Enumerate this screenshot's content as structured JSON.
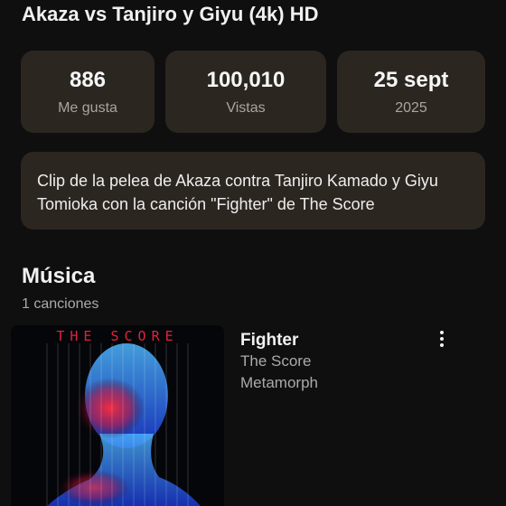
{
  "video": {
    "title": "Akaza vs Tanjiro y Giyu (4k) HD"
  },
  "stats": [
    {
      "value": "886",
      "label": "Me gusta"
    },
    {
      "value": "100,010",
      "label": "Vistas"
    },
    {
      "value": "25 sept",
      "label": "2025"
    }
  ],
  "description": "Clip de la pelea de Akaza contra Tanjiro Kamado y Giyu Tomioka con la canción \"Fighter\" de The Score",
  "music": {
    "heading": "Música",
    "count": "1 canciones",
    "tracks": [
      {
        "title": "Fighter",
        "artist": "The Score",
        "album": "Metamorph",
        "art_text": "THE SCORE",
        "more_icon": "more-vert-icon"
      }
    ]
  },
  "colors": {
    "background": "#0f0f0f",
    "card": "#2c2621",
    "text_primary": "#f1f1f1",
    "text_secondary": "#aaaaaa"
  }
}
